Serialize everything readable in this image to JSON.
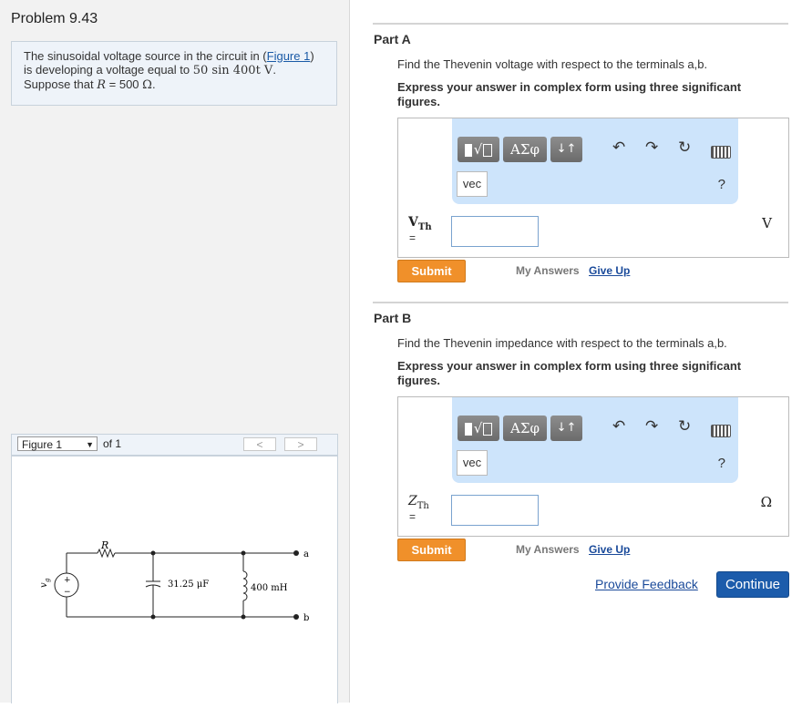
{
  "problem": {
    "title": "Problem 9.43",
    "statement": {
      "line1_pre": "The sinusoidal voltage source in the circuit in (",
      "figure_link": "Figure 1",
      "line1_post": ")",
      "line2_pre": "is developing a voltage equal to ",
      "voltage_expr": "50 sin 400t V",
      "line2_post": ".",
      "line3_pre": "Suppose that ",
      "r_var": "R",
      "line3_eq": " = 500 ",
      "r_unit": "Ω",
      "line3_post": "."
    }
  },
  "figure": {
    "selected": "Figure 1",
    "of_text": "of 1",
    "prev": "<",
    "next": ">",
    "circuit": {
      "resistor": "R",
      "capacitor": "31.25 μF",
      "inductor": "400 mH",
      "source": "v",
      "source_sub": "g",
      "terminal_a": "a",
      "terminal_b": "b",
      "plus": "+",
      "minus": "−"
    }
  },
  "toolbar": {
    "templates_label": "√",
    "greek_label": "ΑΣφ",
    "sort_label": "↓↑",
    "undo_icon": "undo-icon",
    "redo_icon": "redo-icon",
    "reset_icon": "reset-icon",
    "keyboard_icon": "keyboard-icon",
    "vec_label": "vec",
    "help_label": "?"
  },
  "parts": [
    {
      "label": "Part A",
      "prompt": "Find the Thevenin voltage with respect to the terminals a,b.",
      "instruction": "Express your answer in complex form using three significant figures.",
      "var": "V",
      "var_sub": "Th",
      "eq": "=",
      "value": "",
      "unit": "V",
      "submit": "Submit",
      "my_answers": "My Answers",
      "give_up": "Give Up"
    },
    {
      "label": "Part B",
      "prompt": "Find the Thevenin impedance with respect to the terminals a,b.",
      "instruction": "Express your answer in complex form using three significant figures.",
      "var": "Z",
      "var_sub": "Th",
      "eq": "=",
      "value": "",
      "unit": "Ω",
      "submit": "Submit",
      "my_answers": "My Answers",
      "give_up": "Give Up"
    }
  ],
  "footer": {
    "feedback": "Provide Feedback",
    "continue": "Continue"
  },
  "colors": {
    "submit": "#f0902a",
    "continue": "#1c5cab",
    "toolbar": "#cde4fb",
    "link": "#1a4a9a"
  }
}
